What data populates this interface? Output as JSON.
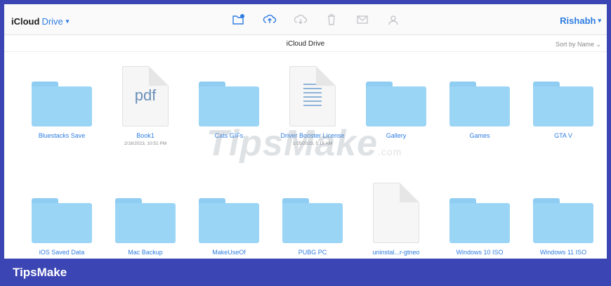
{
  "toolbar": {
    "brand_main": "iCloud",
    "brand_sub": "Drive",
    "brand_chevron": "⌄",
    "user_name": "Rishabh",
    "user_chevron": "⌄",
    "tools": [
      {
        "icon": "new-folder-icon",
        "enabled": true
      },
      {
        "icon": "upload-icon",
        "enabled": true
      },
      {
        "icon": "download-icon",
        "enabled": false
      },
      {
        "icon": "trash-icon",
        "enabled": false
      },
      {
        "icon": "mail-icon",
        "enabled": false
      },
      {
        "icon": "share-person-icon",
        "enabled": false
      }
    ]
  },
  "subheader": {
    "title": "iCloud Drive",
    "sort": "Sort by Name ⌄"
  },
  "items": [
    {
      "kind": "folder",
      "label": "Bluestacks Save",
      "date": ""
    },
    {
      "kind": "pdf",
      "label": "Book1",
      "date": "2/16/2023, 10:51 PM",
      "ext": "pdf"
    },
    {
      "kind": "folder",
      "label": "Cats GIFs",
      "date": ""
    },
    {
      "kind": "text",
      "label": "Driver Booster License",
      "date": "1/25/2023, 5:16 AM"
    },
    {
      "kind": "folder",
      "label": "Gallery",
      "date": ""
    },
    {
      "kind": "folder",
      "label": "Games",
      "date": ""
    },
    {
      "kind": "folder",
      "label": "GTA V",
      "date": ""
    },
    {
      "kind": "folder",
      "label": "iOS Saved Data",
      "date": ""
    },
    {
      "kind": "folder",
      "label": "Mac Backup",
      "date": ""
    },
    {
      "kind": "folder",
      "label": "MakeUseOf",
      "date": ""
    },
    {
      "kind": "folder",
      "label": "PUBG PC",
      "date": ""
    },
    {
      "kind": "blank",
      "label": "uninstal...r-gtneo",
      "date": ""
    },
    {
      "kind": "folder",
      "label": "Windows 10 ISO",
      "date": ""
    },
    {
      "kind": "folder",
      "label": "Windows 11 ISO",
      "date": ""
    }
  ],
  "watermark": {
    "text": "TipsMake",
    "suffix": ".com"
  },
  "footer": {
    "brand": "TipsMake"
  },
  "colors": {
    "accent": "#2f7de1",
    "folder": "#9bd5f6",
    "banner": "#3b45b3"
  }
}
